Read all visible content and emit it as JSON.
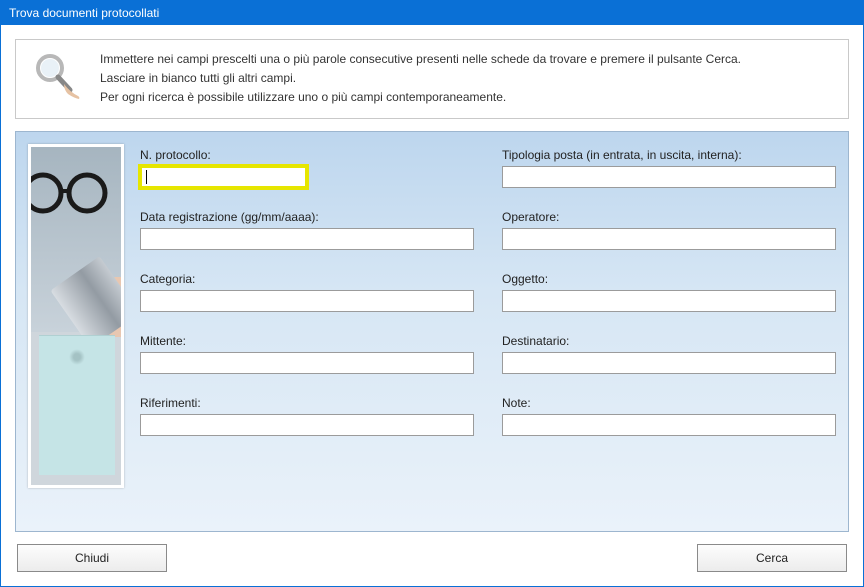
{
  "window": {
    "title": "Trova documenti protocollati"
  },
  "instructions": {
    "line1": "Immettere nei campi prescelti una o più parole consecutive presenti nelle schede da trovare e premere il pulsante Cerca.",
    "line2": "Lasciare in bianco tutti gli altri campi.",
    "line3": "Per ogni ricerca è possibile utilizzare uno o più campi contemporaneamente."
  },
  "fields": {
    "n_protocollo": {
      "label": "N. protocollo:",
      "value": ""
    },
    "tipologia_posta": {
      "label": "Tipologia posta (in entrata, in uscita, interna):",
      "value": ""
    },
    "data_registrazione": {
      "label": "Data registrazione (gg/mm/aaaa):",
      "value": ""
    },
    "operatore": {
      "label": "Operatore:",
      "value": ""
    },
    "categoria": {
      "label": "Categoria:",
      "value": ""
    },
    "oggetto": {
      "label": "Oggetto:",
      "value": ""
    },
    "mittente": {
      "label": "Mittente:",
      "value": ""
    },
    "destinatario": {
      "label": "Destinatario:",
      "value": ""
    },
    "riferimenti": {
      "label": "Riferimenti:",
      "value": ""
    },
    "note": {
      "label": "Note:",
      "value": ""
    }
  },
  "buttons": {
    "close": "Chiudi",
    "search": "Cerca"
  }
}
